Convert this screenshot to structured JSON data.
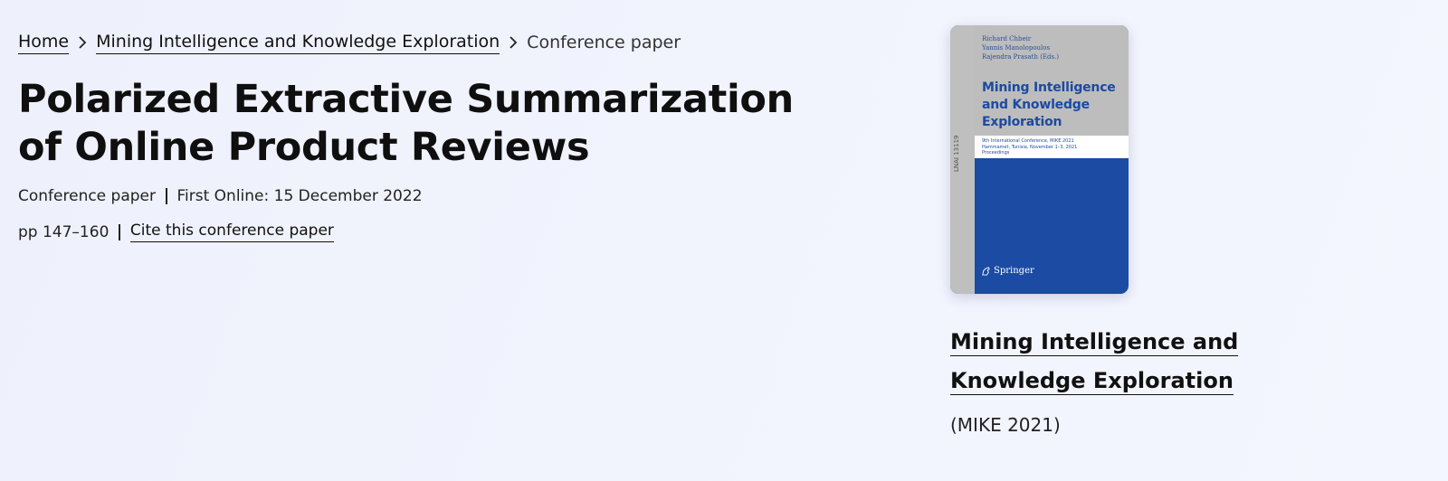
{
  "breadcrumb": {
    "home": "Home",
    "book": "Mining Intelligence and Knowledge Exploration",
    "current": "Conference paper"
  },
  "paper": {
    "title": "Polarized Extractive Summarization of Online Product Reviews",
    "type": "Conference paper",
    "first_online": "First Online: 15 December 2022",
    "pages": "pp 147–160",
    "cite_label": "Cite this conference paper"
  },
  "cover": {
    "editors": [
      "Richard Chbeir",
      "Yannis Manolopoulos",
      "Rajendra Prasath (Eds.)"
    ],
    "title": "Mining Intelligence and Knowledge Exploration",
    "subtitle_lines": [
      "9th International Conference, MIKE 2021",
      "Hammamet, Tunisia, November 1–3, 2021",
      "Proceedings"
    ],
    "series": "LNAI 13119",
    "publisher": "Springer",
    "colors": {
      "main": "#1b4ba3",
      "top": "#bdbdbd",
      "spine": "#bfbfbf"
    }
  },
  "book": {
    "title": "Mining Intelligence and Knowledge Exploration",
    "conference": "(MIKE 2021)"
  }
}
